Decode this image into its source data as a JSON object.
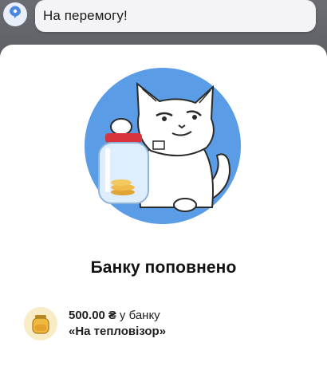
{
  "message": {
    "text": "На перемогу!",
    "icon": "comment-icon"
  },
  "modal": {
    "title": "Банку поповнено",
    "illustration": "cat-with-jar-illustration",
    "accent_color": "#5a9ce6",
    "deposit": {
      "amount": "500.00",
      "currency": "₴",
      "suffix": "у банку",
      "jar_name": "«На тепловізор»",
      "icon": "jar-icon"
    }
  }
}
